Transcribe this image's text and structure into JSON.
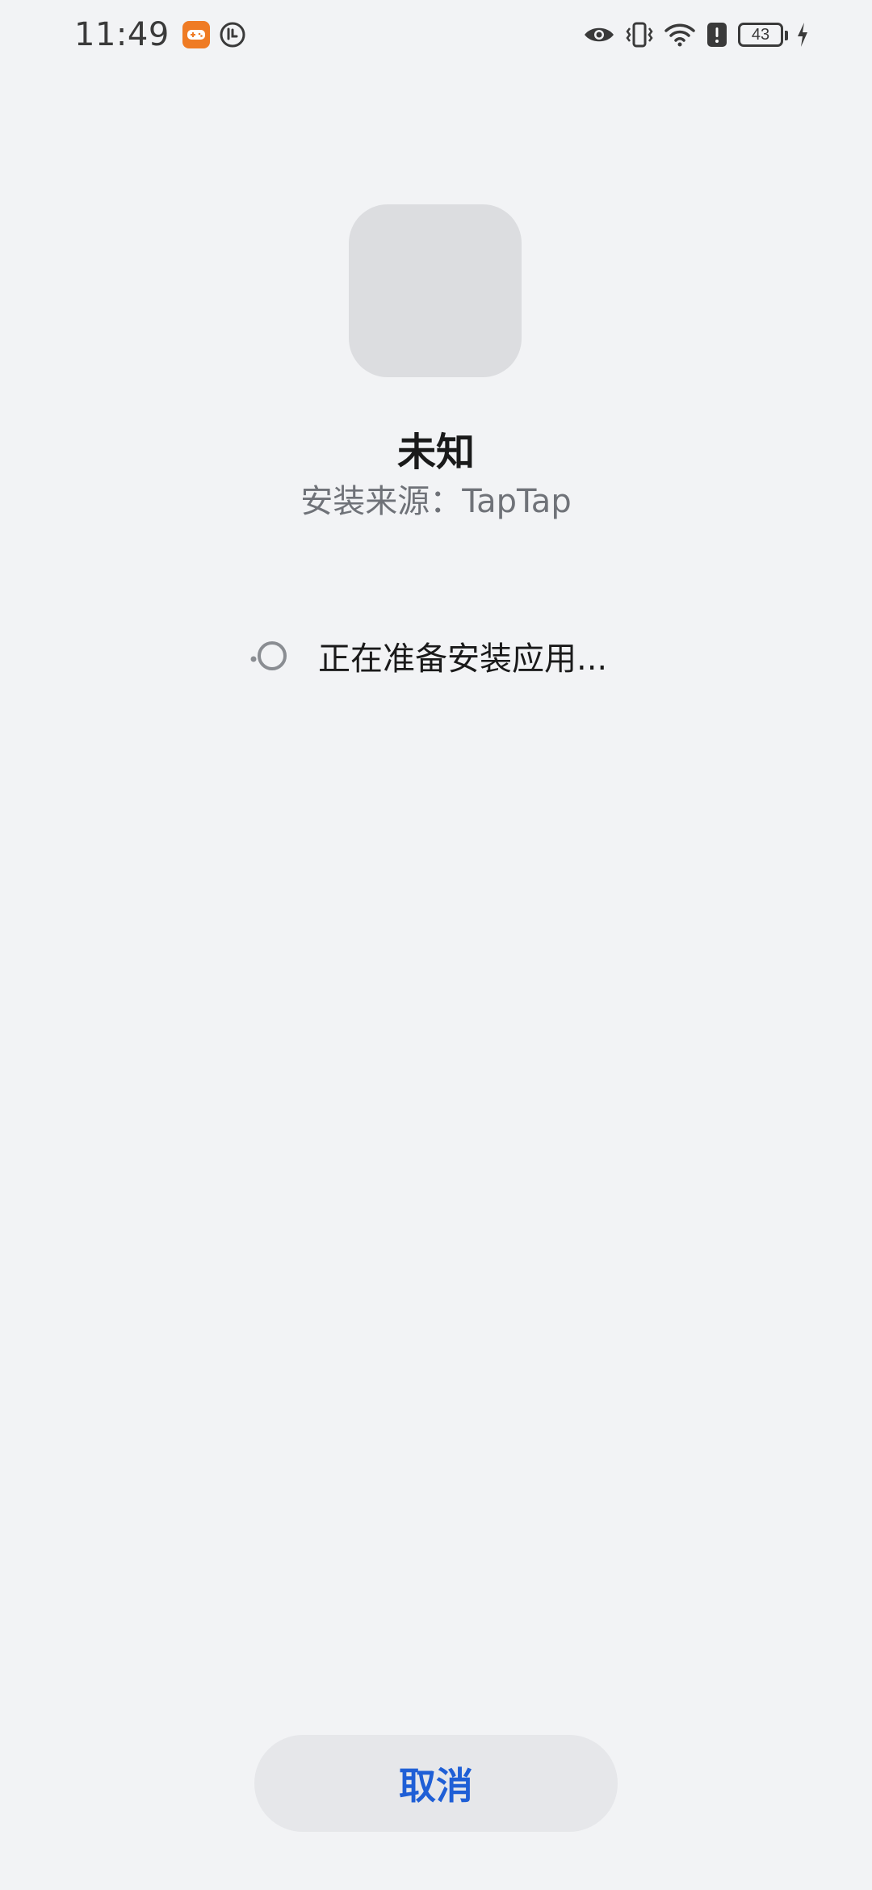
{
  "status_bar": {
    "time": "11:49",
    "battery_level": "43",
    "icons": {
      "left": [
        "game-mode-icon",
        "clock-badge-icon"
      ],
      "right": [
        "eye-icon",
        "vibrate-icon",
        "wifi-icon",
        "alert-icon",
        "battery-icon",
        "charging-icon"
      ]
    }
  },
  "app": {
    "name": "未知",
    "source": "安装来源：TapTap"
  },
  "progress": {
    "text": "正在准备安装应用..."
  },
  "actions": {
    "cancel_label": "取消"
  },
  "colors": {
    "background": "#f2f3f5",
    "accent": "#1f5fd6",
    "button_bg": "#e6e7ea",
    "icon_placeholder": "#dcdde0"
  }
}
